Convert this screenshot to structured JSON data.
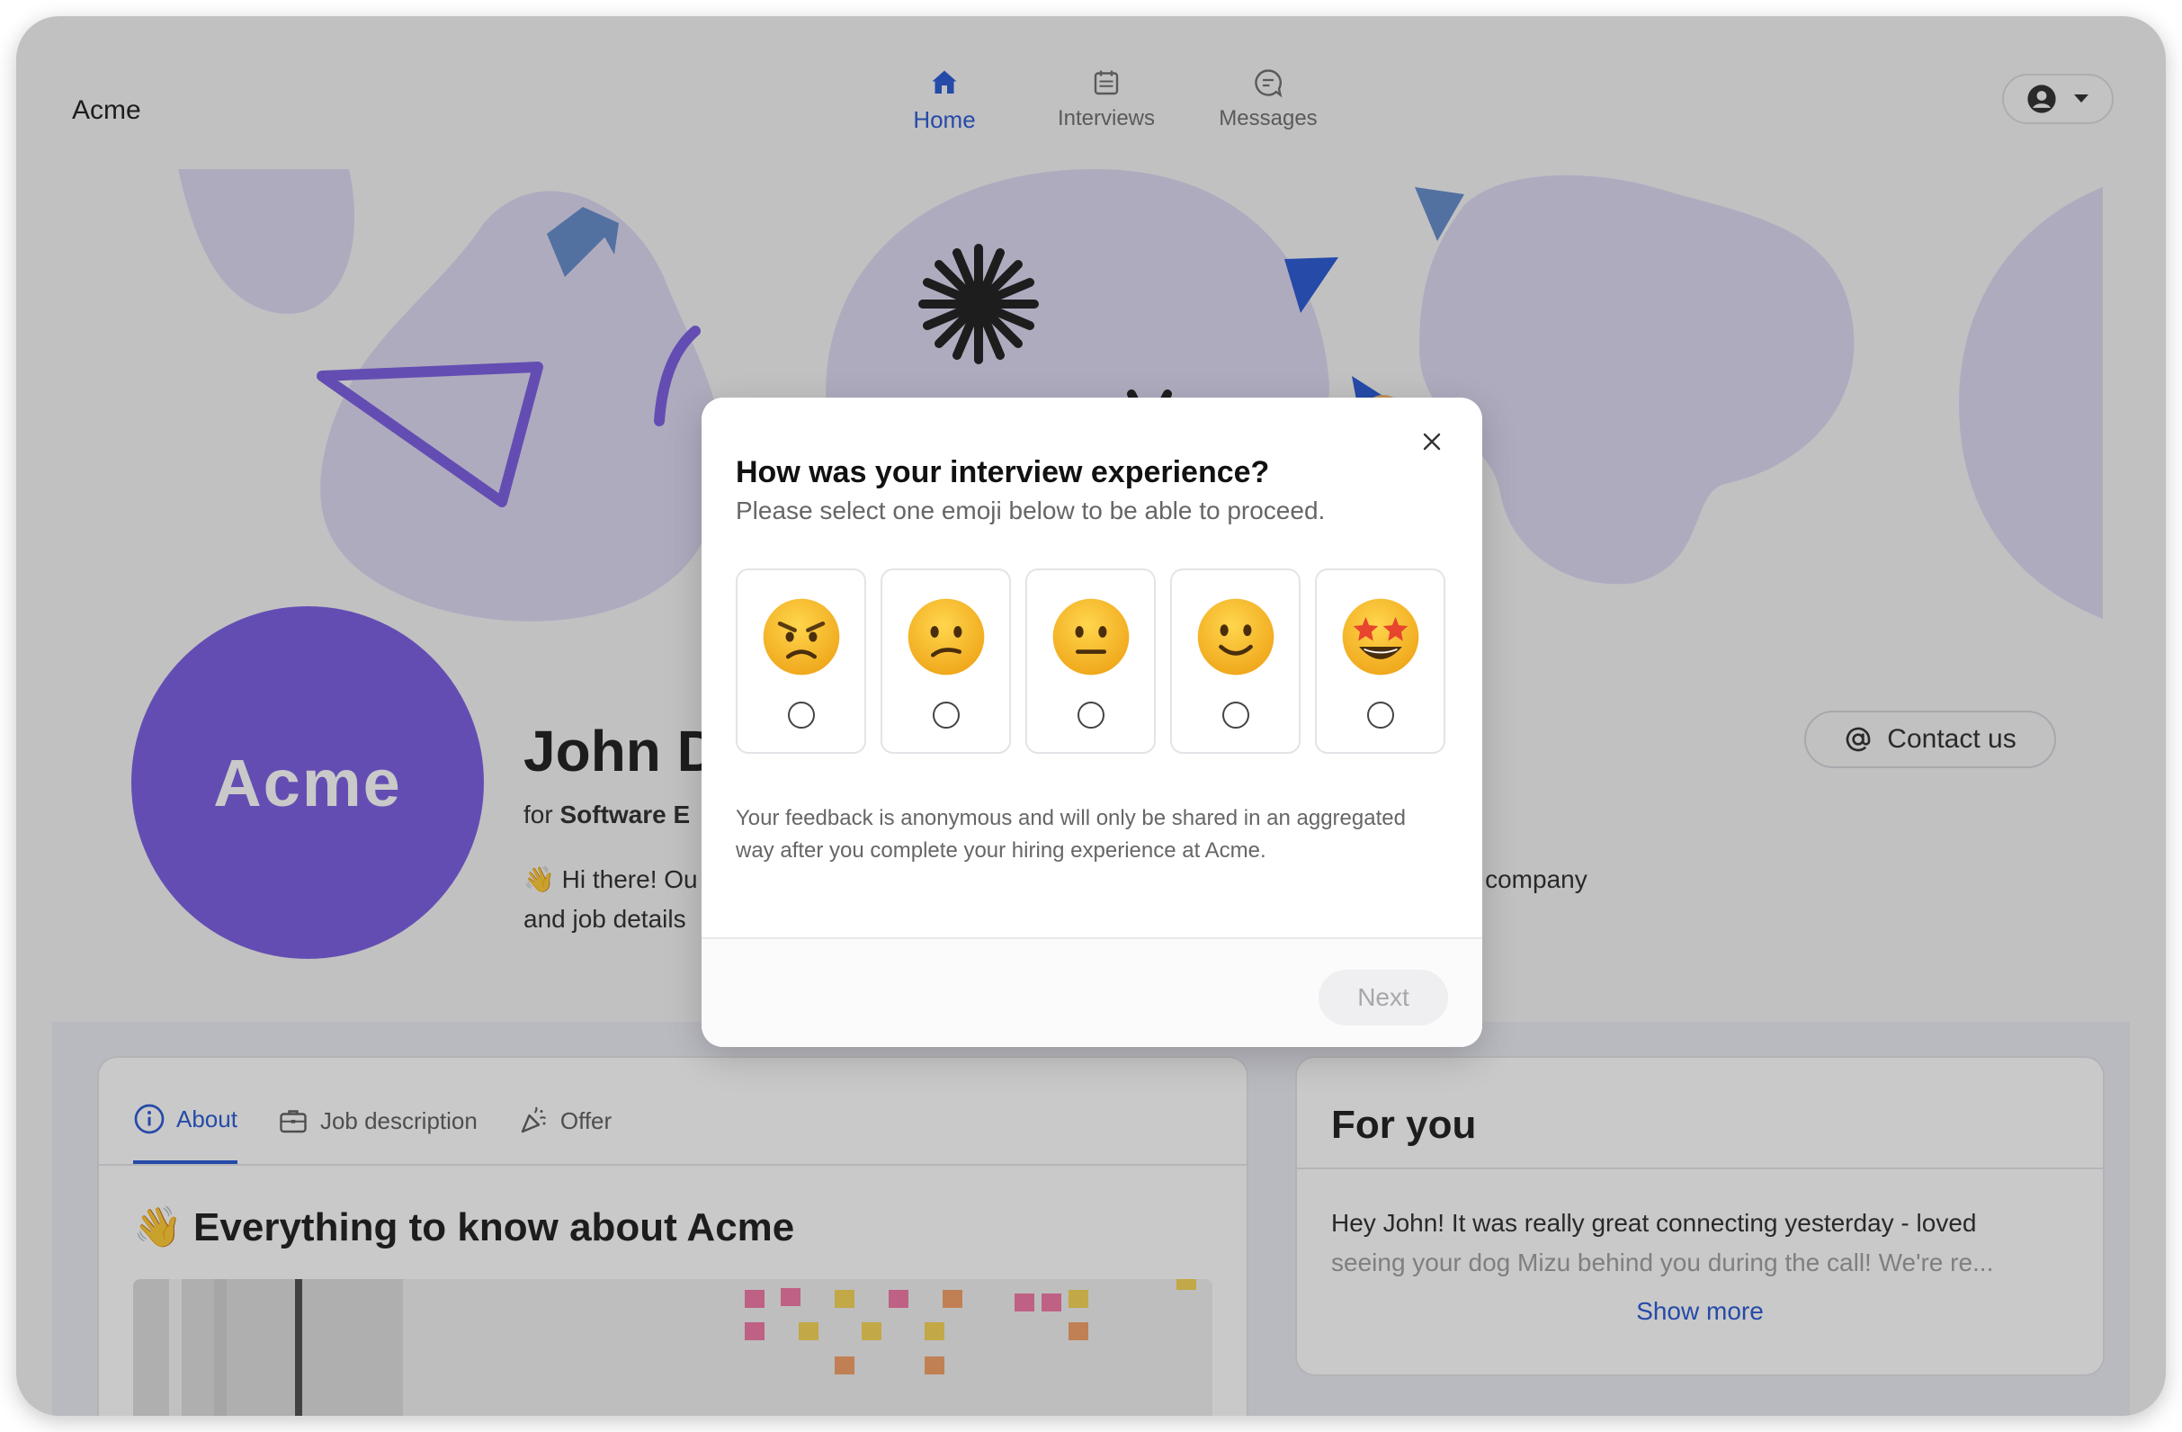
{
  "app": {
    "brand": "Acme"
  },
  "nav": {
    "items": [
      {
        "label": "Home",
        "icon": "home-icon",
        "active": true
      },
      {
        "label": "Interviews",
        "icon": "calendar-icon",
        "active": false
      },
      {
        "label": "Messages",
        "icon": "chat-icon",
        "active": false
      }
    ]
  },
  "profile": {
    "icon": "user-icon",
    "dropdown_icon": "caret-down-icon"
  },
  "candidate": {
    "logo_text": "Acme",
    "name": "John D",
    "role_prefix": "for ",
    "role": "Software E",
    "intro_left": "Hi there! Ou",
    "intro_left2": "and job details",
    "intro_right": "r company",
    "intro_emoji": "👋"
  },
  "contact": {
    "label": "Contact us",
    "icon": "at-icon"
  },
  "tabs": [
    {
      "label": "About",
      "icon": "info-icon",
      "active": true
    },
    {
      "label": "Job description",
      "icon": "briefcase-icon",
      "active": false
    },
    {
      "label": "Offer",
      "icon": "party-icon",
      "active": false
    }
  ],
  "about": {
    "emoji": "👋",
    "title": "Everything to know about Acme"
  },
  "for_you": {
    "title": "For you",
    "message_line1": "Hey John! It was really great connecting yesterday - loved",
    "message_line2": "seeing your dog Mizu behind you during the call! We're re...",
    "show_more": "Show more"
  },
  "modal": {
    "title": "How was your interview experience?",
    "subtitle": "Please select one emoji below to be able to proceed.",
    "options": [
      {
        "name": "angry",
        "icon": "angry-face-icon"
      },
      {
        "name": "confused",
        "icon": "confused-face-icon"
      },
      {
        "name": "neutral",
        "icon": "neutral-face-icon"
      },
      {
        "name": "smile",
        "icon": "smiling-face-icon"
      },
      {
        "name": "star-struck",
        "icon": "star-struck-face-icon"
      }
    ],
    "note": "Your feedback is anonymous and will only be shared in an aggregated way after you complete your hiring experience at Acme.",
    "next_label": "Next",
    "close_icon": "close-icon"
  },
  "colors": {
    "accent": "#1d4fd1",
    "brand_purple": "#7454e0",
    "emoji_yellow": "#f9c22e"
  }
}
